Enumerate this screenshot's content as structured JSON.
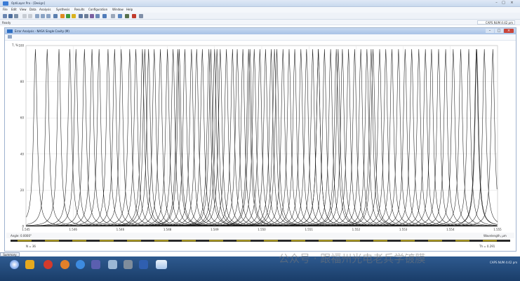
{
  "window": {
    "title": "OptiLayer Pro - [Design]",
    "minimize_glyph": "–",
    "maximize_glyph": "□",
    "close_glyph": "×"
  },
  "menu": [
    "File",
    "Edit",
    "View",
    "Data",
    "Analysis",
    "Synthesis",
    "Results",
    "Configuration",
    "Window",
    "Help"
  ],
  "status": {
    "ready": "Ready",
    "clock": "CAPS  NUM  4:42 pm"
  },
  "document": {
    "title": "Error Analysis - NASA Single Cavity (M)",
    "close_glyph": "×",
    "minimize_glyph": "–",
    "maximize_glyph": "□"
  },
  "axis": {
    "y_label": "T, %",
    "x_label": "Wavelength, µm",
    "angle_label": "Angle: 0.0000°"
  },
  "footer": {
    "n_label": "N = 36",
    "th_label": "Th = 0.291"
  },
  "summary_tab": "Summary",
  "watermark": "公众号 · 跟福州光电老兵学镀膜",
  "chart_data": {
    "type": "line",
    "title": "",
    "xlabel": "Wavelength, µm",
    "ylabel": "T, %",
    "xlim": [
      1.545,
      1.555
    ],
    "ylim": [
      0,
      100
    ],
    "x_ticks": [
      1.545,
      1.546,
      1.547,
      1.548,
      1.549,
      1.55,
      1.551,
      1.552,
      1.553,
      1.554,
      1.555
    ],
    "x_tick_labels": [
      "1.545",
      "1.546",
      "1.546",
      "1.548",
      "1.549",
      "1.550",
      "1.551",
      "1.552",
      "1.553",
      "1.554",
      "1.555"
    ],
    "y_ticks": [
      0,
      20,
      40,
      60,
      80,
      100
    ],
    "y_tick_labels": [
      "0",
      "20",
      "40",
      "60",
      "80",
      "100"
    ],
    "grid": true,
    "peak_width": 4.5e-05,
    "series_peaks": [
      1.5452,
      1.54545,
      1.5457,
      1.54593,
      1.54606,
      1.54624,
      1.5464,
      1.54655,
      1.54674,
      1.54688,
      1.54702,
      1.5472,
      1.54733,
      1.54747,
      1.5476,
      1.54772,
      1.54785,
      1.548,
      1.54812,
      1.54825,
      1.54837,
      1.54851,
      1.54862,
      1.54874,
      1.54888,
      1.549,
      1.54912,
      1.54925,
      1.54938,
      1.54948,
      1.5496,
      1.54972,
      1.54984,
      1.54996,
      1.55008,
      1.5502,
      1.55032,
      1.55045,
      1.55058,
      1.5507,
      1.55083,
      1.55095,
      1.55108,
      1.5512,
      1.55133,
      1.55146,
      1.55158,
      1.55171,
      1.55184,
      1.55197,
      1.5521,
      1.55223,
      1.55236,
      1.5525,
      1.55263,
      1.55276,
      1.5529,
      1.55304,
      1.55318,
      1.55333,
      1.55347,
      1.5536,
      1.55375,
      1.5539,
      1.55406,
      1.55422,
      1.55439,
      1.55455,
      1.55472,
      1.5549,
      1.55456,
      1.54975,
      1.54905,
      1.5512,
      1.54822,
      1.55027,
      1.55232,
      1.54892,
      1.55162,
      1.54752
    ]
  }
}
